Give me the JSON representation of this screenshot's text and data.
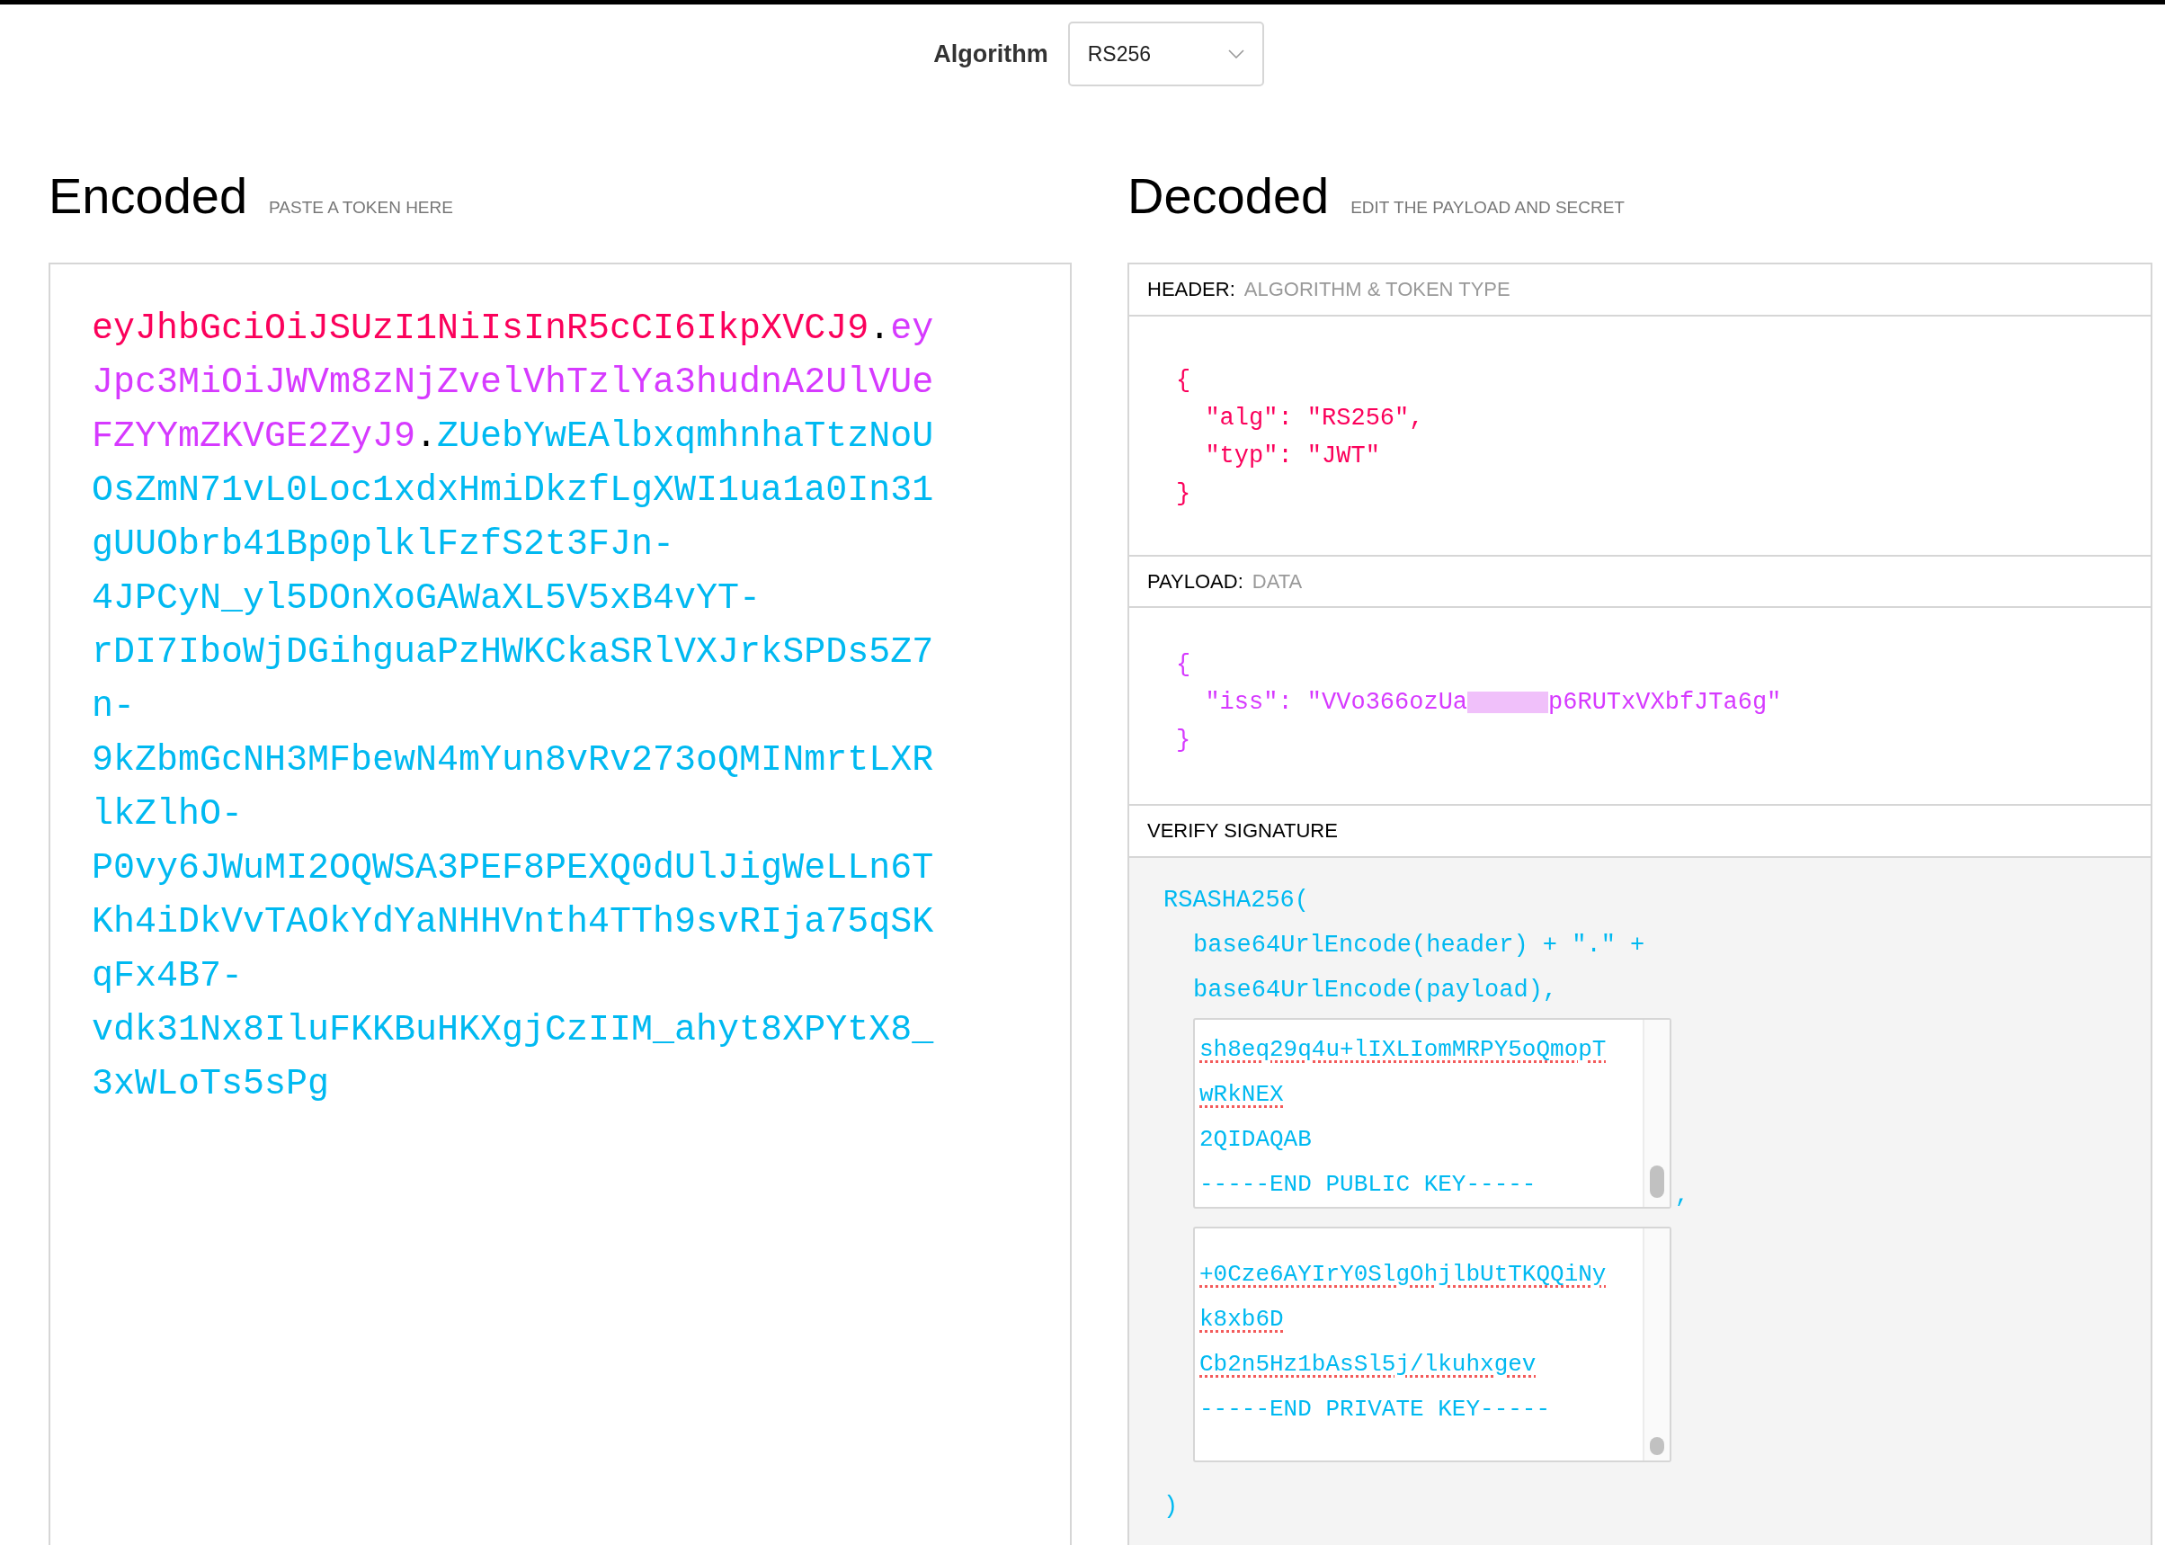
{
  "algorithm": {
    "label": "Algorithm",
    "value": "RS256"
  },
  "encoded": {
    "title": "Encoded",
    "hint": "PASTE A TOKEN HERE",
    "token": [
      {
        "kind": "header",
        "text": "eyJhbGciOiJSUzI1NiIsInR5cCI6IkpXVCJ9"
      },
      {
        "kind": "dot",
        "text": "."
      },
      {
        "kind": "payload",
        "text": "eyJpc3MiOiJWVm8zNjZvelVhTzlYa3hudnA2UlVUeFZYYmZKVGE2ZyJ9"
      },
      {
        "kind": "dot",
        "text": "."
      },
      {
        "kind": "signature",
        "text": "ZUebYwEAlbxqmhnhaTtzNoUOsZmN71vL0Loc1xdxHmiDkzfLgXWI1ua1a0In31gUUObrb41Bp0plklFzfS2t3FJn-4JPCyN_yl5DOnXoGAWaXL5V5xB4vYT-rDI7IboWjDGihguaPzHWKCkaSRlVXJrkSPDs5Z7n-9kZbmGcNH3MFbewN4mYun8vRv273oQMINmrtLXRlkZlhO-P0vy6JWuMI2OQWSA3PEF8PEXQ0dUlJigWeLLn6TKh4iDkVvTAOkYdYaNHHVnth4TTh9svRIja75qSKqFx4B7-vdk31Nx8IluFKKBuHKXgjCzIIM_ahyt8XPYtX8_3xWLoTs5sPg"
      }
    ]
  },
  "decoded": {
    "title": "Decoded",
    "hint": "EDIT THE PAYLOAD AND SECRET",
    "header": {
      "label": "HEADER:",
      "sublabel": "ALGORITHM & TOKEN TYPE",
      "lines": [
        "{",
        "  \"alg\": \"RS256\",",
        "  \"typ\": \"JWT\"",
        "}"
      ]
    },
    "payload": {
      "label": "PAYLOAD:",
      "sublabel": "DATA",
      "open": "{",
      "key": "  \"iss\": ",
      "value_start": "\"VVo366ozUa",
      "value_end": "p6RUTxVXbfJTa6g\"",
      "close": "}"
    },
    "verify": {
      "label": "VERIFY SIGNATURE",
      "call": "RSASHA256(",
      "arg_header": "base64UrlEncode(header) + \".\" +",
      "arg_payload": "base64UrlEncode(payload),",
      "public_key": [
        {
          "text": "sh8eq29q4u+lIXLIomMRPY5oQmopT",
          "flagged": true
        },
        {
          "text": "wRkNEX",
          "flagged": true
        },
        {
          "text": "2QIDAQAB",
          "flagged": false
        },
        {
          "text": "-----END PUBLIC KEY-----",
          "flagged": false
        }
      ],
      "comma": ",",
      "private_key": [
        {
          "text": "+0Cze6AYIrY0SlgOhjlbUtTKQQiNy",
          "flagged": true
        },
        {
          "text": "k8xb6D",
          "flagged": true
        },
        {
          "text": "Cb2n5Hz1bAsSl5j/lkuhxgev",
          "flagged": true
        },
        {
          "text": "-----END PRIVATE KEY-----",
          "flagged": false
        }
      ],
      "close": ")"
    }
  }
}
